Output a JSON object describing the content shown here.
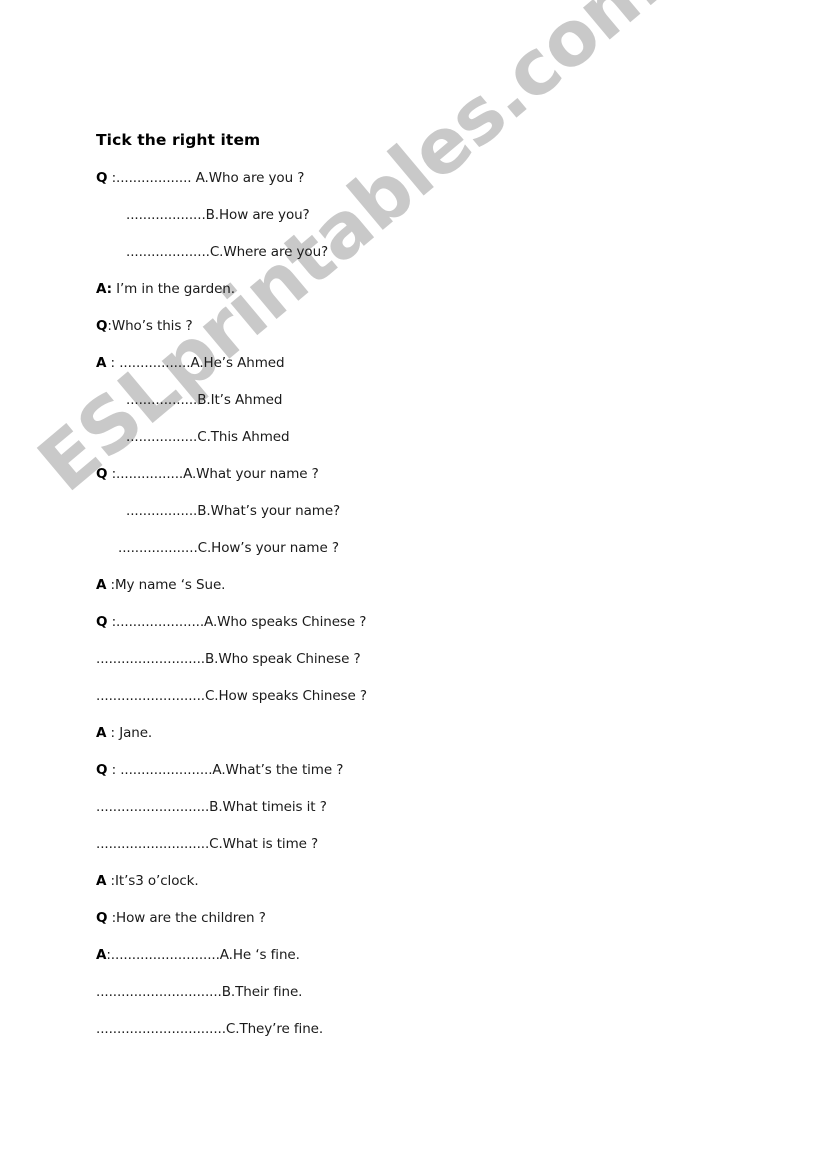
{
  "document": {
    "title": "Tick the right item",
    "watermark": "ESLprintables.com",
    "watermark_color": "#c9c9c9",
    "background_color": "#ffffff",
    "text_color": "#1a1a1a"
  },
  "lines": [
    {
      "tag": "Q",
      "text": " :.................. A.Who are you ?",
      "indent": "indent-0"
    },
    {
      "tag": "",
      "text": "...................B.How are you?",
      "indent": "indent-lg"
    },
    {
      "tag": "",
      "text": "....................C.Where are you?",
      "indent": "indent-lg"
    },
    {
      "tag": "A:",
      "text": " I’m in the garden.",
      "indent": "indent-0"
    },
    {
      "tag": "Q",
      "text": ":Who’s this ?",
      "indent": "indent-0"
    },
    {
      "tag": "A",
      "text": " : .................A.He’s Ahmed",
      "indent": "indent-0"
    },
    {
      "tag": "",
      "text": ".................B.It’s Ahmed",
      "indent": "indent-lg"
    },
    {
      "tag": "",
      "text": ".................C.This Ahmed",
      "indent": "indent-lg"
    },
    {
      "tag": "Q",
      "text": " :................A.What your name ?",
      "indent": "indent-0"
    },
    {
      "tag": "",
      "text": ".................B.What’s your name?",
      "indent": "indent-lg"
    },
    {
      "tag": "",
      "text": "...................C.How’s your name ?",
      "indent": "indent-md"
    },
    {
      "tag": "A",
      "text": " :My name ‘s Sue.",
      "indent": "indent-0"
    },
    {
      "tag": "Q",
      "text": " :.....................A.Who speaks Chinese ?",
      "indent": "indent-0"
    },
    {
      "tag": "",
      "text": "..........................B.Who speak Chinese ?",
      "indent": "indent-0"
    },
    {
      "tag": "",
      "text": "..........................C.How speaks Chinese ?",
      "indent": "indent-0"
    },
    {
      "tag": "A",
      "text": " : Jane.",
      "indent": "indent-0"
    },
    {
      "tag": "Q",
      "text": " : ......................A.What’s the time ?",
      "indent": "indent-0"
    },
    {
      "tag": "",
      "text": "...........................B.What timeis it ?",
      "indent": "indent-0"
    },
    {
      "tag": "",
      "text": "...........................C.What is time ?",
      "indent": "indent-0"
    },
    {
      "tag": "A",
      "text": " :It’s3 o’clock.",
      "indent": "indent-0"
    },
    {
      "tag": "Q",
      "text": " :How are the children ?",
      "indent": "indent-0"
    },
    {
      "tag": "A",
      "text": ":..........................A.He ‘s fine.",
      "indent": "indent-0"
    },
    {
      "tag": "",
      "text": "..............................B.Their fine.",
      "indent": "indent-0"
    },
    {
      "tag": "",
      "text": "...............................C.They’re fine.",
      "indent": "indent-0"
    }
  ]
}
